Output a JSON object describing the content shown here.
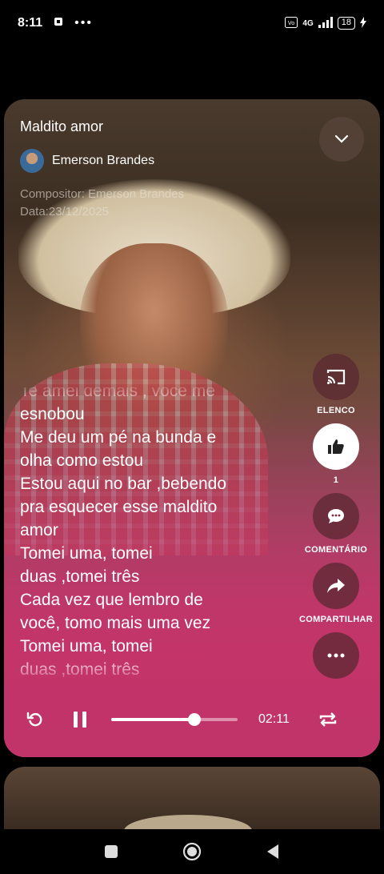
{
  "status_bar": {
    "time": "8:11",
    "dots": "•••",
    "network": "4G",
    "battery": "18"
  },
  "song": {
    "title": "Maldito amor",
    "artist": "Emerson Brandes",
    "composer": "Compositor: Emerson Brandes",
    "date": "Data:23/12/2025"
  },
  "lyrics": [
    "Te amei demais , você me",
    "esnobou",
    "Me deu um pé na bunda e",
    "olha como estou",
    "Estou aqui no bar ,bebendo",
    "pra esquecer esse maldito",
    "amor",
    "Tomei uma, tomei",
    "duas ,tomei três",
    "Cada vez que lembro de",
    "você, tomo mais uma vez",
    "Tomei uma, tomei",
    "duas ,tomei três"
  ],
  "actions": {
    "cast_label": "ELENCO",
    "like_count": "1",
    "comment_label": "COMENTÁRIO",
    "share_label": "COMPARTILHAR"
  },
  "player": {
    "time": "02:11",
    "progress_fraction": 0.66
  },
  "colors": {
    "accent": "#c0346a"
  }
}
